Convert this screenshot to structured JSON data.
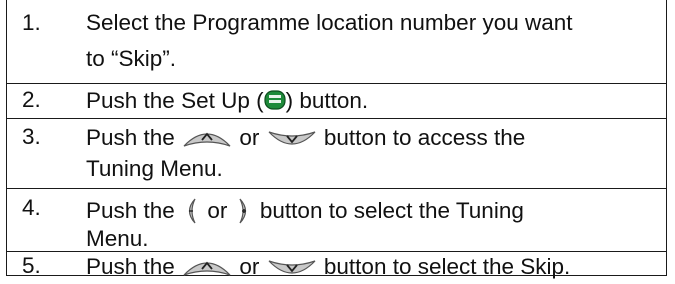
{
  "steps": [
    {
      "number": "1.",
      "lines": [
        "Select the Programme location number you want",
        "to “Skip”."
      ]
    },
    {
      "number": "2.",
      "prefix": "Push the Set Up (",
      "suffix": ") button."
    },
    {
      "number": "3.",
      "prefix": "Push the",
      "middle": "or",
      "suffix": "button to access the",
      "line2": "Tuning Menu."
    },
    {
      "number": "4.",
      "prefix": "Push the",
      "middle": "or",
      "suffix": "button to select the Tuning",
      "line2": "Menu."
    },
    {
      "number": "5.",
      "prefix": "Push the",
      "middle": "or",
      "suffix": "button to select the Skip."
    }
  ],
  "icons": {
    "setup": "setup-button-icon",
    "up": "up-arrow-button-icon",
    "down": "down-arrow-button-icon",
    "left": "left-minus-button-icon",
    "right": "right-plus-button-icon"
  },
  "colors": {
    "setup_green": "#1e8a3a",
    "button_grey": "#b8b8b8"
  }
}
